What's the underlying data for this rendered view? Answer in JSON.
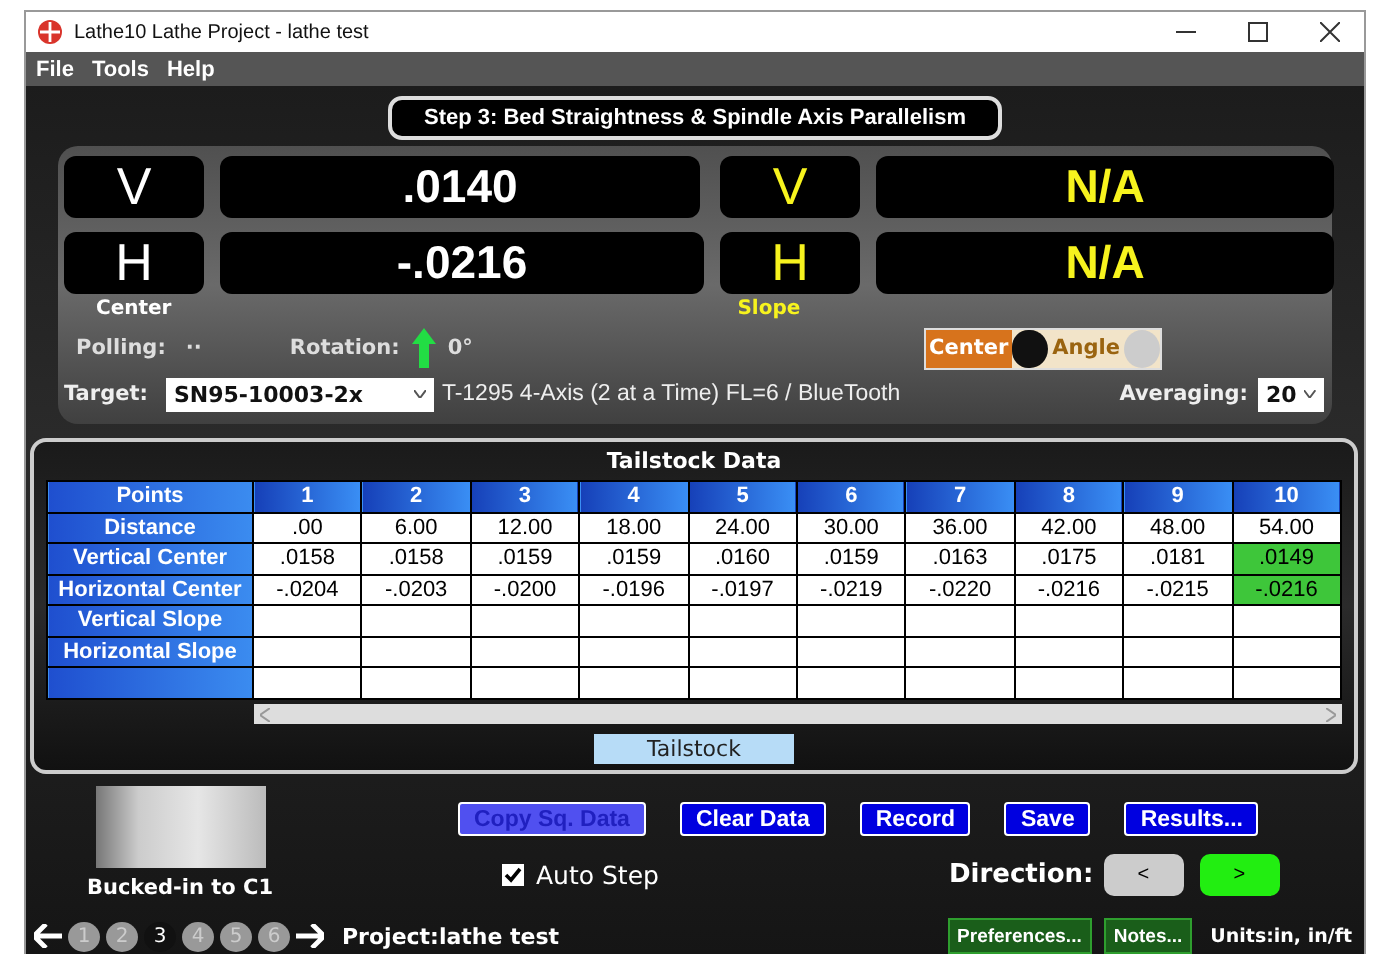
{
  "window": {
    "title": "Lathe10 Lathe Project - lathe test"
  },
  "menu": [
    "File",
    "Tools",
    "Help"
  ],
  "step_title": "Step 3: Bed Straightness & Spindle Axis Parallelism",
  "readouts": [
    {
      "kind": "center",
      "axis": "V",
      "value": ".0140"
    },
    {
      "kind": "slope",
      "axis": "V",
      "value": "N/A"
    },
    {
      "kind": "center",
      "axis": "H",
      "value": "-.0216"
    },
    {
      "kind": "slope",
      "axis": "H",
      "value": "N/A"
    }
  ],
  "center_label": "Center",
  "slope_label": "Slope",
  "polling": {
    "label": "Polling:",
    "value": "··"
  },
  "rotation": {
    "label": "Rotation:",
    "value": "0°"
  },
  "mode_toggle": [
    {
      "label": "Center",
      "selected": true
    },
    {
      "label": "Angle",
      "selected": false
    }
  ],
  "target": {
    "label": "Target:",
    "value": "SN95-10003-2x",
    "description": "T-1295 4-Axis (2 at a Time) FL=6 / BlueTooth"
  },
  "averaging": {
    "label": "Averaging:",
    "value": "20"
  },
  "table": {
    "title": "Tailstock Data",
    "corner": "Points",
    "columns": [
      "1",
      "2",
      "3",
      "4",
      "5",
      "6",
      "7",
      "8",
      "9",
      "10"
    ],
    "rows": [
      {
        "label": "Distance",
        "cells": [
          {
            "text": ".00",
            "highlighted": false
          },
          {
            "text": "6.00",
            "highlighted": false
          },
          {
            "text": "12.00",
            "highlighted": false
          },
          {
            "text": "18.00",
            "highlighted": false
          },
          {
            "text": "24.00",
            "highlighted": false
          },
          {
            "text": "30.00",
            "highlighted": false
          },
          {
            "text": "36.00",
            "highlighted": false
          },
          {
            "text": "42.00",
            "highlighted": false
          },
          {
            "text": "48.00",
            "highlighted": false
          },
          {
            "text": "54.00",
            "highlighted": false
          }
        ]
      },
      {
        "label": "Vertical Center",
        "cells": [
          {
            "text": ".0158",
            "highlighted": false
          },
          {
            "text": ".0158",
            "highlighted": false
          },
          {
            "text": ".0159",
            "highlighted": false
          },
          {
            "text": ".0159",
            "highlighted": false
          },
          {
            "text": ".0160",
            "highlighted": false
          },
          {
            "text": ".0159",
            "highlighted": false
          },
          {
            "text": ".0163",
            "highlighted": false
          },
          {
            "text": ".0175",
            "highlighted": false
          },
          {
            "text": ".0181",
            "highlighted": false
          },
          {
            "text": ".0149",
            "highlighted": true
          }
        ]
      },
      {
        "label": "Horizontal Center",
        "cells": [
          {
            "text": "-.0204",
            "highlighted": false
          },
          {
            "text": "-.0203",
            "highlighted": false
          },
          {
            "text": "-.0200",
            "highlighted": false
          },
          {
            "text": "-.0196",
            "highlighted": false
          },
          {
            "text": "-.0197",
            "highlighted": false
          },
          {
            "text": "-.0219",
            "highlighted": false
          },
          {
            "text": "-.0220",
            "highlighted": false
          },
          {
            "text": "-.0216",
            "highlighted": false
          },
          {
            "text": "-.0215",
            "highlighted": false
          },
          {
            "text": "-.0216",
            "highlighted": true
          }
        ]
      },
      {
        "label": "Vertical Slope"
      },
      {
        "label": "Horizontal Slope"
      },
      {}
    ],
    "tabs": [
      {
        "label": "Tailstock",
        "selected": true
      }
    ]
  },
  "photo_caption": "Bucked-in to C1",
  "actions": [
    {
      "label": "Copy Sq. Data",
      "disabled": true
    },
    {
      "label": "Clear Data",
      "disabled": false
    },
    {
      "label": "Record",
      "disabled": false
    },
    {
      "label": "Save",
      "disabled": false
    },
    {
      "label": "Results...",
      "disabled": false
    }
  ],
  "auto_step": {
    "label": "Auto Step",
    "checked": true
  },
  "direction": {
    "label": "Direction:",
    "options": [
      {
        "label": "<",
        "selected": false
      },
      {
        "label": ">",
        "selected": true
      }
    ]
  },
  "steps": [
    {
      "label": "1",
      "selected": false
    },
    {
      "label": "2",
      "selected": false
    },
    {
      "label": "3",
      "selected": true
    },
    {
      "label": "4",
      "selected": false
    },
    {
      "label": "5",
      "selected": false
    },
    {
      "label": "6",
      "selected": false
    }
  ],
  "project": "Project:lathe test",
  "footer_buttons": [
    "Preferences...",
    "Notes..."
  ],
  "units": "Units:in, in/ft"
}
